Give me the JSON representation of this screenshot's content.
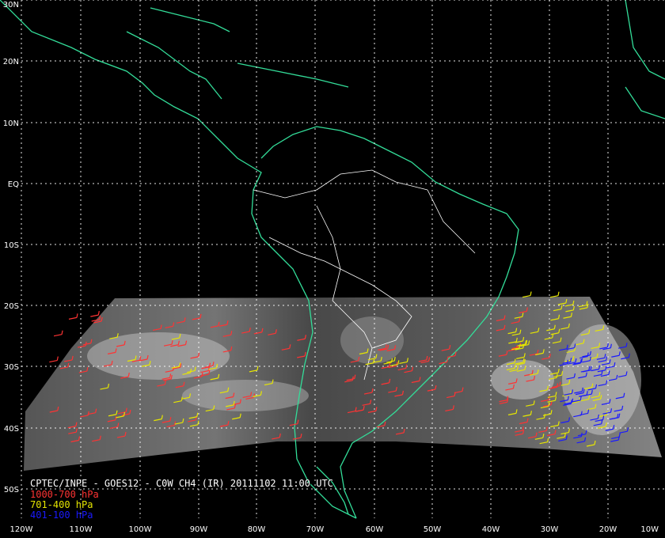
{
  "title": "CPTEC/INPE - GOES12 - C0W CH4 (IR) 20111102 11:00 UTC",
  "legend": [
    {
      "label": "1000-700 hPa",
      "color": "#ff3333"
    },
    {
      "label": "701-400 hPa",
      "color": "#e6e600"
    },
    {
      "label": "401-100 hPa",
      "color": "#1a1aff"
    }
  ],
  "lat_labels": [
    "30N",
    "20N",
    "10N",
    "EQ",
    "10S",
    "20S",
    "30S",
    "40S",
    "50S"
  ],
  "lon_labels": [
    "120W",
    "110W",
    "100W",
    "90W",
    "80W",
    "70W",
    "60W",
    "50W",
    "40W",
    "30W",
    "20W",
    "10W"
  ],
  "colors": {
    "coast": "#33dd99",
    "border": "#ffffff",
    "grid": "#ffffff",
    "background": "#000000"
  }
}
